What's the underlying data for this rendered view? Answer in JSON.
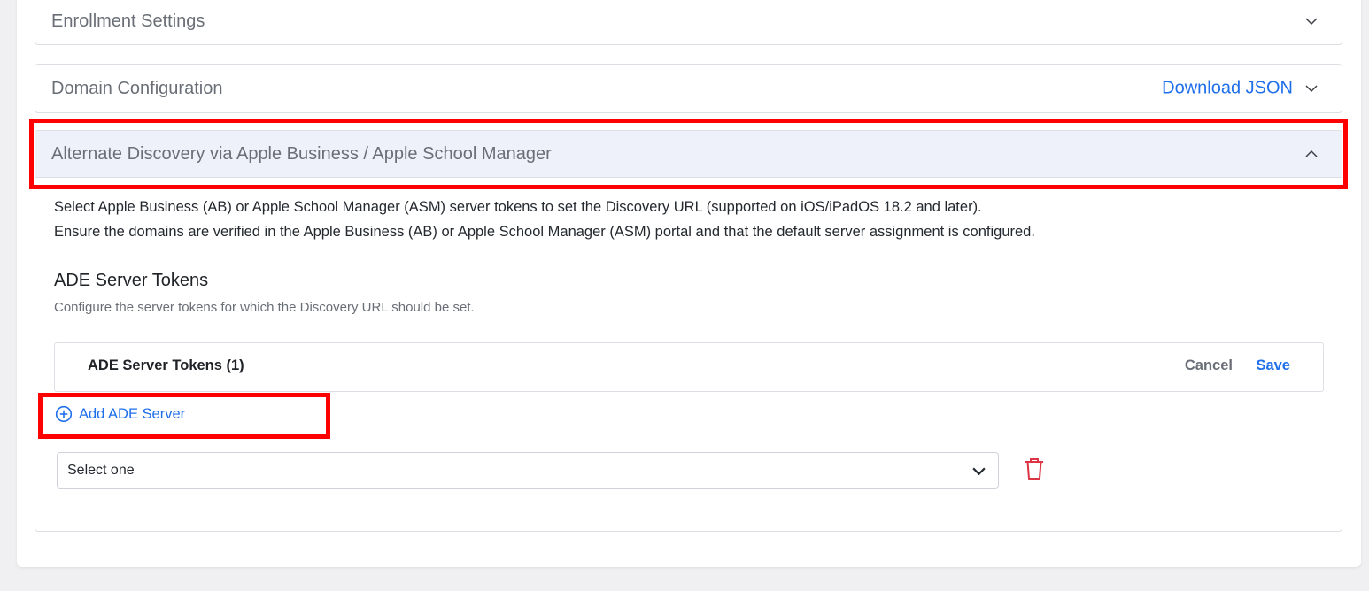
{
  "sections": {
    "enrollment": {
      "title": "Enrollment Settings",
      "state": "collapsed"
    },
    "domain": {
      "title": "Domain Configuration",
      "download_label": "Download JSON",
      "state": "collapsed"
    },
    "alternate": {
      "title": "Alternate Discovery via Apple Business / Apple School Manager",
      "state": "expanded",
      "description_line1": "Select Apple Business (AB) or Apple School Manager (ASM) server tokens to set the Discovery URL (supported on iOS/iPadOS 18.2 and later).",
      "description_line2": "Ensure the domains are verified in the Apple Business (AB) or Apple School Manager (ASM) portal and that the default server assignment is configured."
    }
  },
  "ade_tokens": {
    "heading": "ADE Server Tokens",
    "subheading": "Configure the server tokens for which the Discovery URL should be set.",
    "panel_title": "ADE Server Tokens (1)",
    "cancel_label": "Cancel",
    "save_label": "Save",
    "add_label": "Add ADE Server",
    "select_value": "Select one"
  },
  "icons": {
    "collapse": "chevron-down-icon",
    "expand": "chevron-up-icon",
    "add": "plus-circle-icon",
    "delete": "trash-icon"
  },
  "colors": {
    "link": "#1f6feb",
    "highlight": "#ff0000",
    "danger": "#dc3545",
    "active_header": "#eef1fa"
  }
}
